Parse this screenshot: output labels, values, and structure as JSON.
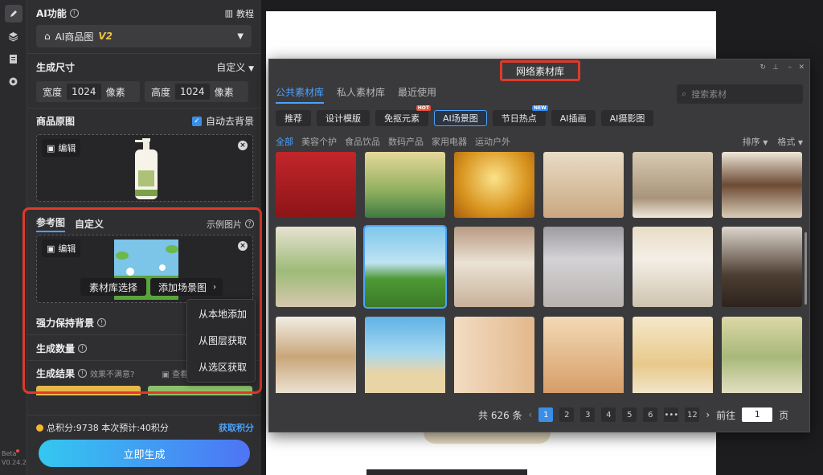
{
  "rail": {
    "version_label": "Beta",
    "version": "V0.24.2"
  },
  "panel": {
    "ai_function_label": "AI功能",
    "tutorial_label": "教程",
    "mode_select": "AI商品图",
    "mode_badge": "V2",
    "size_label": "生成尺寸",
    "size_preset": "自定义",
    "width_label": "宽度",
    "width_value": "1024",
    "width_unit": "像素",
    "height_label": "高度",
    "height_value": "1024",
    "height_unit": "像素",
    "original_label": "商品原图",
    "auto_bg_label": "自动去背景",
    "edit_label": "编辑",
    "ref_tab": "参考图",
    "custom_tab": "自定义",
    "example_label": "示例图片",
    "library_btn": "素材库选择",
    "add_scene_btn": "添加场景图",
    "keep_bg_label": "强力保持背景",
    "count_label": "生成数量",
    "result_label": "生成结果",
    "unsatisfied_label": "效果不满意?",
    "view_label": "查看",
    "menu_items": [
      "从本地添加",
      "从图层获取",
      "从选区获取"
    ],
    "points_text": "总积分:9738  本次预计:40积分",
    "get_points": "获取积分",
    "generate_btn": "立即生成"
  },
  "modal": {
    "title": "网络素材库",
    "tabs": [
      "公共素材库",
      "私人素材库",
      "最近使用"
    ],
    "search_placeholder": "搜索素材",
    "chips": [
      {
        "label": "推荐",
        "tag": ""
      },
      {
        "label": "设计模版",
        "tag": ""
      },
      {
        "label": "免抠元素",
        "tag": "HOT"
      },
      {
        "label": "AI场景图",
        "tag": ""
      },
      {
        "label": "节日热点",
        "tag": "NEW"
      },
      {
        "label": "AI插画",
        "tag": ""
      },
      {
        "label": "AI摄影图",
        "tag": ""
      }
    ],
    "categories": [
      "全部",
      "美容个护",
      "食品饮品",
      "数码产品",
      "家用电器",
      "运动户外"
    ],
    "sort_label": "排序",
    "format_label": "格式",
    "total_text": "共 626 条",
    "pages": [
      "1",
      "2",
      "3",
      "4",
      "5",
      "6",
      "•••",
      "12"
    ],
    "goto_label": "前往",
    "goto_value": "1",
    "page_unit": "页"
  },
  "colors": {
    "accent": "#4aa3ff",
    "highlight_red": "#e03a2a",
    "hot": "#e8503a",
    "new": "#2f8af5"
  }
}
